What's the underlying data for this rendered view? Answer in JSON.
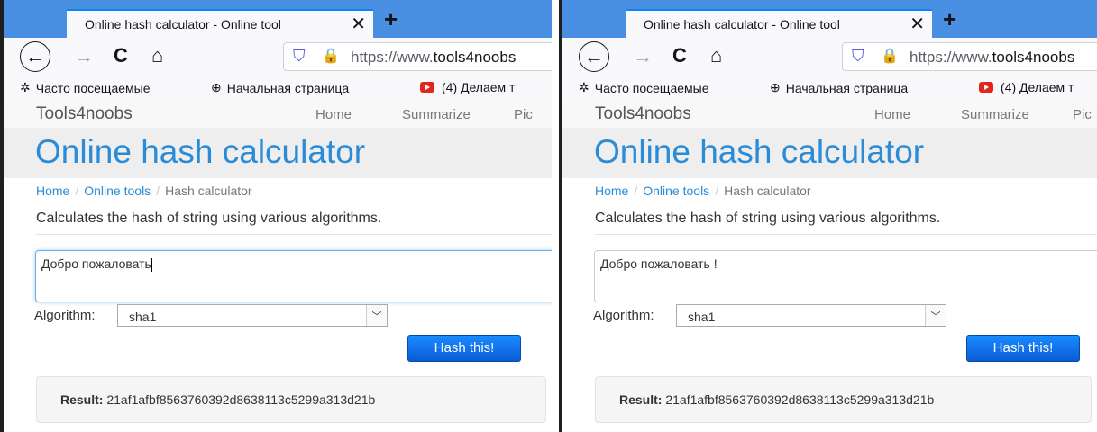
{
  "browser": {
    "tab_title": "Online hash calculator - Online tool",
    "tab_close": "✕",
    "new_tab": "+",
    "url_prefix": "https://www.",
    "url_host": "tools4noobs",
    "bookmarks": [
      {
        "label": "Часто посещаемые"
      },
      {
        "label": "Начальная страница"
      },
      {
        "label": "(4) Делаем т"
      }
    ]
  },
  "site": {
    "brand": "Tools4noobs",
    "nav": [
      "Home",
      "Summarize",
      "Pic"
    ],
    "title": "Online hash calculator",
    "breadcrumb": [
      "Home",
      "Online tools",
      "Hash calculator"
    ],
    "description": "Calculates the hash of string using various algorithms.",
    "algorithm_label": "Algorithm:",
    "hash_button": "Hash this!",
    "result_label": "Result:"
  },
  "windows": [
    {
      "input_text": "Добро пожаловать",
      "algorithm": "sha1",
      "result_value": "21af1afbf8563760392d8638113c5299a313d21b"
    },
    {
      "input_text": "Добро пожаловать !",
      "algorithm": "sha1",
      "result_value": "21af1afbf8563760392d8638113c5299a313d21b"
    }
  ],
  "colors": {
    "tabstrip": "#4a90e2",
    "accent_link": "#2a8bd6",
    "button": "#0a5bd6"
  }
}
